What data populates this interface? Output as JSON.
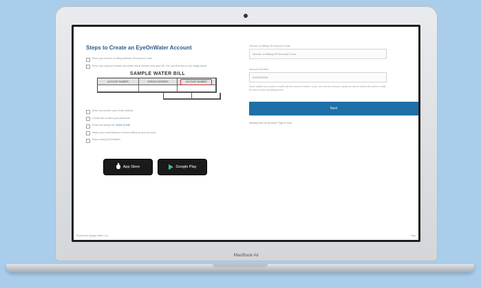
{
  "page": {
    "title": "Steps to Create an EyeOnWater Account",
    "steps_top": [
      "Enter your service or billing address OR Account Code",
      "Enter your account number and meter serial number from your bill. You can find them in the image below."
    ],
    "bill": {
      "title": "SAMPLE WATER BILL",
      "headers": [
        "ACCOUNT NUMBER",
        "SERVICE ADDRESS",
        "ACCOUNT NUMBER"
      ],
      "row": [
        "",
        "",
        ""
      ],
      "totals": [
        "",
        ""
      ]
    },
    "steps_bottom": [
      "Enter and confirm your email address",
      "Create and confirm your password",
      "Read and accept the Terms of Use",
      "Verify your email address to finish setting up your account",
      "Enjoy using EyeOnWater!"
    ],
    "terms_link": "Terms of Use",
    "app_store": "App Store",
    "google_play": "Google Play",
    "right": {
      "address_label": "Service or Billing OR Account Code",
      "address_placeholder": "Service or Billing OR Account Code",
      "account_label": "Account Number",
      "account_value": "0000000000",
      "help_text": "Some utilities use a prefix or suffix with the account number. If you can't find the account, please try with or without the prefix or suffix. Be sure to enter all leading zeros.",
      "button_label": "Next",
      "signin_text": "Already have an account? Sign In here."
    },
    "footer_left": "Powered by Badger Meter, Inc.",
    "footer_right": "Help"
  },
  "device_label": "MacBook Air",
  "colors": {
    "background": "#a9cdea",
    "accent": "#1f6fa8",
    "title": "#2b5b86",
    "highlight": "#d0333a"
  }
}
